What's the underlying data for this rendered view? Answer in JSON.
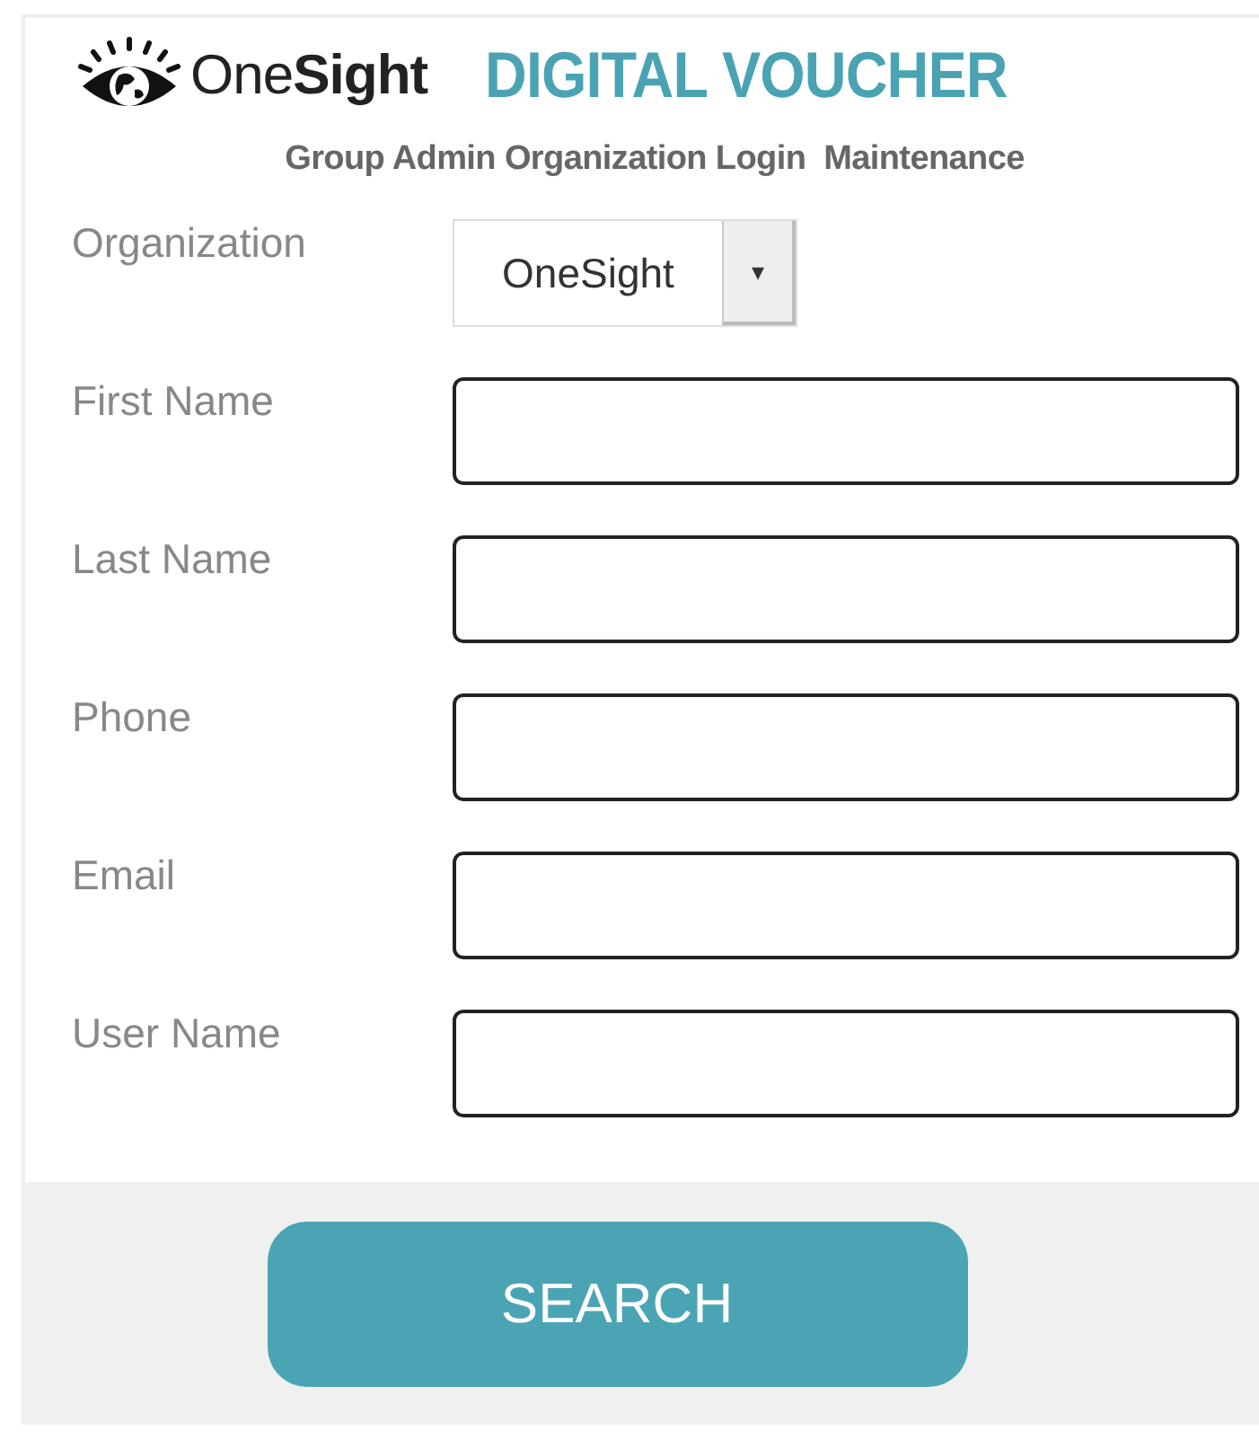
{
  "logo": {
    "text": "One**Sight**"
  },
  "title": "DIGITAL VOUCHER",
  "subtitle": "Group Admin Organization Login  Maintenance",
  "organization": {
    "label": "Organization",
    "value": "OneSight",
    "arrow": "▾"
  },
  "fields": [
    {
      "label": "First Name"
    },
    {
      "label": "Last Name"
    },
    {
      "label": "Phone"
    },
    {
      "label": "Email"
    },
    {
      "label": "User Name"
    }
  ],
  "button": "SEARCH"
}
